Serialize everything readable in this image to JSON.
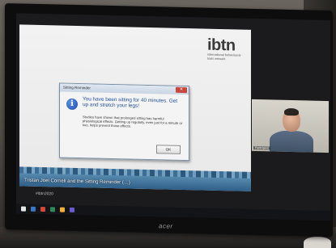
{
  "dialog": {
    "title": "Sitting Reminder",
    "close_label": "✕",
    "icon": "info-icon",
    "headline": "You have been sitting for 40 minutes. Get up and stretch your legs!",
    "body": "Studies have shown that prolonged sitting has harmful physiological effects. Getting up regularly, even just for a minute or two, helps prevent those effects.",
    "ok_label": "OK"
  },
  "slide": {
    "logo": "ibtn",
    "logo_sub": "international behavioural trials network",
    "caption": "Tristan Joel Cornell and the Sitting Reminder (…)",
    "hashtag": "#ibtn2020"
  },
  "video": {
    "participant_name": "Participant"
  },
  "monitor": {
    "brand": "acer"
  },
  "colors": {
    "dialog_headline": "#1f4f9a",
    "skyline": "#2f5f88",
    "close_button": "#c9463d"
  }
}
